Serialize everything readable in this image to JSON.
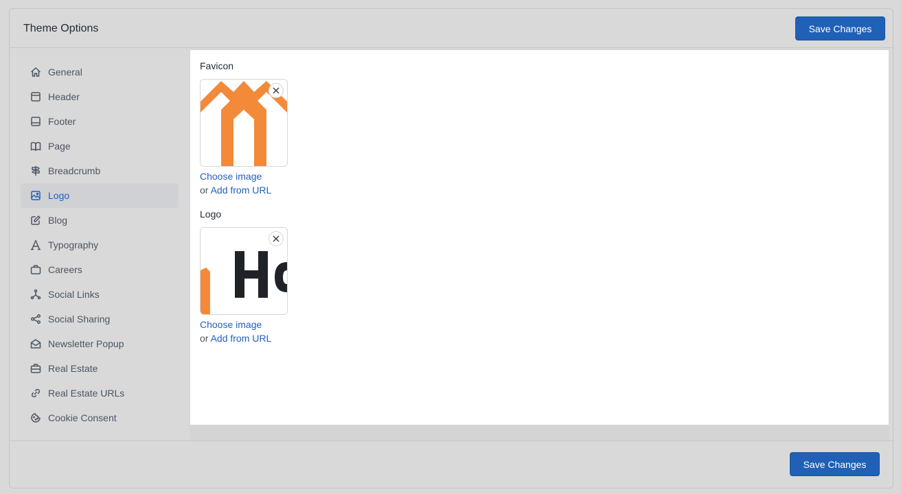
{
  "header": {
    "title": "Theme Options",
    "save_label": "Save Changes"
  },
  "footer": {
    "save_label": "Save Changes"
  },
  "sidebar": {
    "items": [
      {
        "label": "General",
        "icon": "home-icon"
      },
      {
        "label": "Header",
        "icon": "layout-top-icon"
      },
      {
        "label": "Footer",
        "icon": "layout-bottom-icon"
      },
      {
        "label": "Page",
        "icon": "book-icon"
      },
      {
        "label": "Breadcrumb",
        "icon": "signpost-icon"
      },
      {
        "label": "Logo",
        "icon": "image-icon",
        "active": true
      },
      {
        "label": "Blog",
        "icon": "edit-icon"
      },
      {
        "label": "Typography",
        "icon": "typography-icon"
      },
      {
        "label": "Careers",
        "icon": "briefcase-icon"
      },
      {
        "label": "Social Links",
        "icon": "share-network-icon"
      },
      {
        "label": "Social Sharing",
        "icon": "share-icon"
      },
      {
        "label": "Newsletter Popup",
        "icon": "mail-opened-icon"
      },
      {
        "label": "Real Estate",
        "icon": "briefcase-2-icon"
      },
      {
        "label": "Real Estate URLs",
        "icon": "link-icon"
      },
      {
        "label": "Cookie Consent",
        "icon": "cookie-icon"
      }
    ]
  },
  "fields": {
    "favicon": {
      "label": "Favicon",
      "choose": "Choose image",
      "or": "or",
      "url": "Add from URL"
    },
    "logo": {
      "label": "Logo",
      "choose": "Choose image",
      "or": "or",
      "url": "Add from URL"
    }
  },
  "colors": {
    "accent": "#2060b6",
    "brand_orange": "#f28a3a",
    "logo_dark": "#1f2328"
  }
}
